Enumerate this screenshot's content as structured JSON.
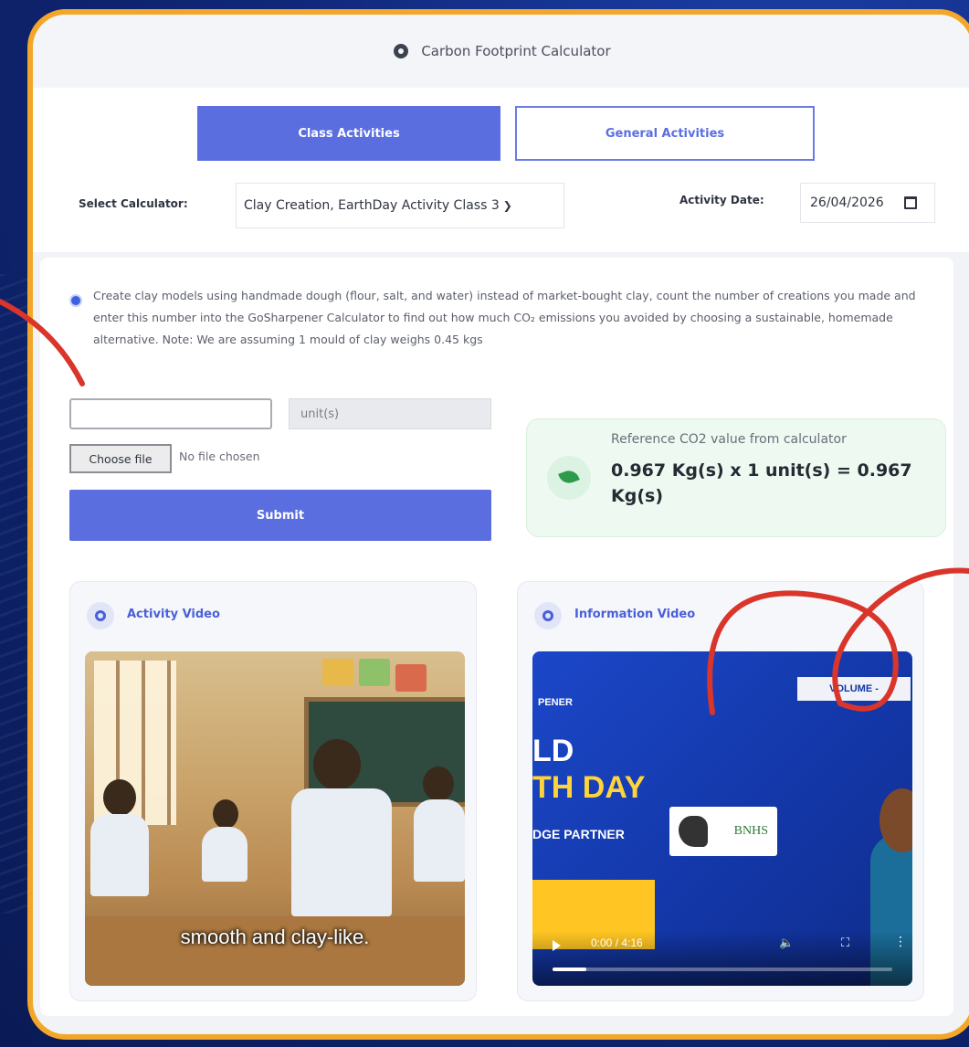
{
  "window": {
    "title": "Carbon Footprint Calculator"
  },
  "tabs": [
    {
      "label": "Class Activities",
      "active": true
    },
    {
      "label": "General Activities",
      "active": false
    }
  ],
  "form": {
    "select_label": "Select Calculator:",
    "selected_calculator": "Clay Creation, EarthDay Activity Class 3",
    "date_label": "Activity Date:",
    "date_value": "26/04/2026"
  },
  "activity": {
    "description": "Create clay models using handmade dough (flour, salt, and water) instead of market-bought clay, count the number of creations you made and enter this number into the GoSharpener Calculator to find out how much CO₂ emissions you avoided by choosing a sustainable, homemade alternative. Note: We are assuming 1 mould of clay weighs 0.45 kgs",
    "quantity_value": "",
    "unit_label": "unit(s)",
    "file_button": "Choose file",
    "file_status": "No file chosen",
    "submit_label": "Submit"
  },
  "reference": {
    "label": "Reference CO2 value from calculator",
    "value": "0.967 Kg(s) x 1 unit(s) = 0.967 Kg(s)"
  },
  "videos": {
    "activity": {
      "title": "Activity Video",
      "caption": "smooth and clay-like."
    },
    "information": {
      "title": "Information Video",
      "brand": "PENER",
      "headline1": "LD",
      "headline2": "TH DAY",
      "partner_text": "DGE PARTNER",
      "partner_logo": "BNHS",
      "volume_tag": "VOLUME -",
      "time": "0:00 / 4:16",
      "progress": 0.1
    }
  },
  "colors": {
    "accent": "#5b6ee0",
    "frame": "#f2a72a",
    "success_bg": "#eef9f1",
    "annotation": "#d9352b"
  }
}
